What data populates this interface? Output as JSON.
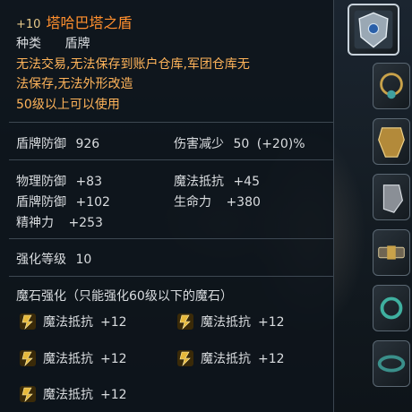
{
  "item": {
    "enhance_prefix": "+10",
    "name": "塔哈巴塔之盾",
    "category_label": "种类",
    "category_value": "盾牌",
    "restriction": "无法交易,无法保存到账户仓库,军团仓库无法保存,无法外形改造",
    "restriction_line1": "无法交易,无法保存到账户仓库,军团仓库无",
    "restriction_line2": "法保存,无法外形改造",
    "level_req": "50级以上可以使用"
  },
  "main_stats": {
    "shield_def_label": "盾牌防御",
    "shield_def_value": "926",
    "dmg_reduce_label": "伤害减少",
    "dmg_reduce_value": "50",
    "dmg_reduce_bonus": "(+20)%"
  },
  "bonus_stats": {
    "phys_def_label": "物理防御",
    "phys_def_value": "+83",
    "magic_resist_label": "魔法抵抗",
    "magic_resist_value": "+45",
    "shield_def_label": "盾牌防御",
    "shield_def_value": "+102",
    "hp_label": "生命力",
    "hp_value": "+380",
    "spirit_label": "精神力",
    "spirit_value": "+253"
  },
  "enhance": {
    "label": "强化等级",
    "value": "10"
  },
  "manastone": {
    "header": "魔石强化（只能强化60级以下的魔石）",
    "slots": [
      {
        "label": "魔法抵抗",
        "value": "+12"
      },
      {
        "label": "魔法抵抗",
        "value": "+12"
      },
      {
        "label": "魔法抵抗",
        "value": "+12"
      },
      {
        "label": "魔法抵抗",
        "value": "+12"
      },
      {
        "label": "魔法抵抗",
        "value": "+12"
      }
    ]
  },
  "colors": {
    "item_name": "#ff8f2e",
    "bonus": "#7fe08a",
    "gem": "#e6b83a"
  }
}
